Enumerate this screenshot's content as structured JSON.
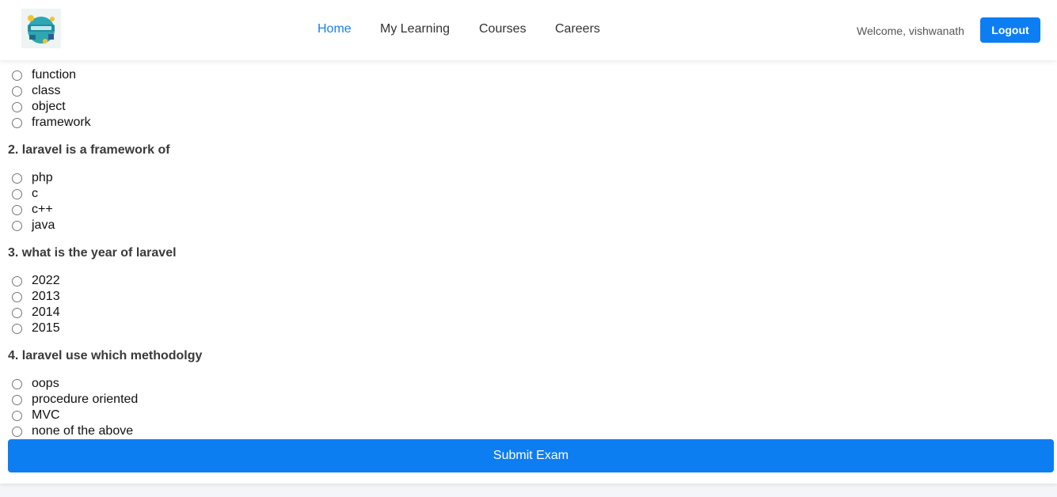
{
  "nav": {
    "links": [
      "Home",
      "My Learning",
      "Courses",
      "Careers"
    ],
    "active": "Home",
    "welcome": "Welcome, vishwanath",
    "logout_label": "Logout"
  },
  "exam": {
    "q1": {
      "options": [
        "function",
        "class",
        "object",
        "framework"
      ]
    },
    "q2": {
      "title": "2. laravel is a framework of",
      "options": [
        "php",
        "c",
        "c++",
        "java"
      ]
    },
    "q3": {
      "title": "3. what is the year of laravel",
      "options": [
        "2022",
        "2013",
        "2014",
        "2015"
      ]
    },
    "q4": {
      "title": "4. laravel use which methodolgy",
      "options": [
        "oops",
        "procedure oriented",
        "MVC",
        "none of the above"
      ]
    },
    "submit_label": "Submit Exam"
  },
  "colors": {
    "accent": "#0d7ef2",
    "active_link": "#1a7fe8"
  }
}
